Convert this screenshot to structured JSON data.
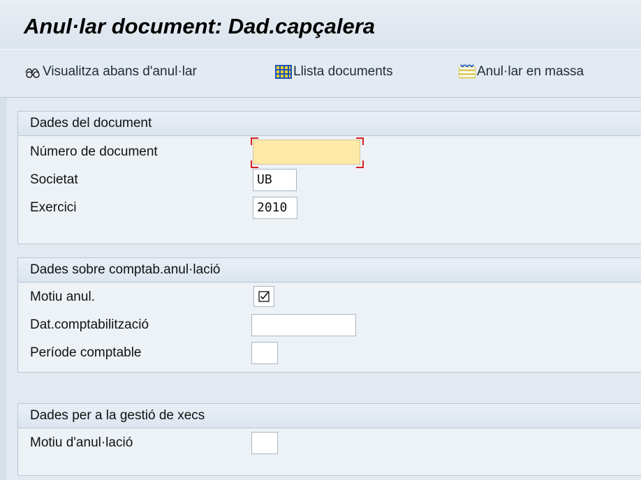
{
  "window": {
    "title": "Anul·lar document: Dad.capçalera"
  },
  "toolbar": {
    "display_before_cancel": {
      "label": "Visualitza abans d'anul·lar",
      "icon": "glasses-icon"
    },
    "document_list": {
      "label": "Llista documents",
      "icon": "grid-list-icon"
    },
    "mass_cancel": {
      "label": "Anul·lar en massa",
      "icon": "mass-reverse-icon"
    }
  },
  "document_data": {
    "title": "Dades del document",
    "document_number": {
      "label": "Número de document",
      "value": ""
    },
    "company": {
      "label": "Societat",
      "value": "UB"
    },
    "fiscal_year": {
      "label": "Exercici",
      "value": "2010"
    }
  },
  "reversal_posting": {
    "title": "Dades sobre comptab.anul·lació",
    "reason": {
      "label": "Motiu anul."
    },
    "posting_date": {
      "label": "Dat.comptabilització",
      "value": ""
    },
    "posting_period": {
      "label": "Període comptable",
      "value": ""
    }
  },
  "check_management": {
    "title": "Dades per a la gestió de xecs",
    "void_reason": {
      "label": "Motiu d'anul·lació",
      "value": ""
    }
  },
  "colors": {
    "required_field": "#ffe9a6",
    "required_marker": "#d82020",
    "group_header": "#dce5ef",
    "toolbar_background": "#e4eaf1",
    "grid_icon_blue": "#1b55b8",
    "grid_icon_yellow": "#f3d034"
  }
}
